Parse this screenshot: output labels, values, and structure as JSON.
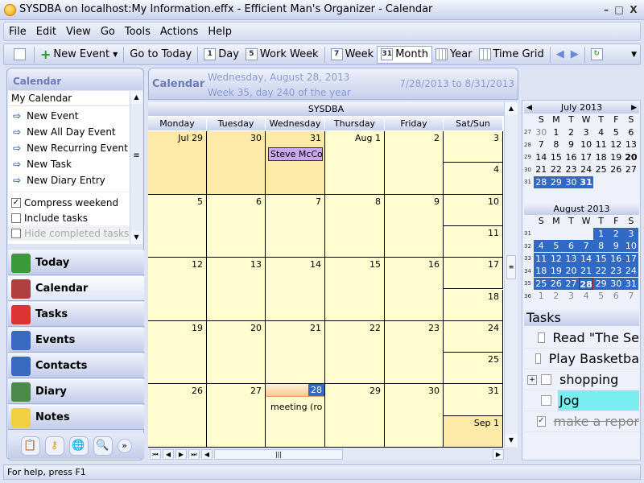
{
  "window": {
    "title": "SYSDBA on localhost:My Information.effx - Efficient Man's Organizer - Calendar"
  },
  "menu": [
    "File",
    "Edit",
    "View",
    "Go",
    "Tools",
    "Actions",
    "Help"
  ],
  "toolbar": {
    "new_event": "New Event",
    "go_today": "Go to Today",
    "day": "Day",
    "work_week": "Work Week",
    "week": "Week",
    "month": "Month",
    "year": "Year",
    "time_grid": "Time Grid",
    "day_icon": "1",
    "ww_icon": "5",
    "week_icon": "7",
    "month_icon": "31",
    "active": "Month"
  },
  "left": {
    "header": "Calendar",
    "calendar_name": "My Calendar",
    "actions": [
      "New Event",
      "New All Day Event",
      "New Recurring Event",
      "New Task",
      "New Diary Entry"
    ],
    "options": [
      {
        "label": "Compress weekend",
        "checked": true,
        "enabled": true
      },
      {
        "label": "Include tasks",
        "checked": false,
        "enabled": true
      },
      {
        "label": "Hide completed tasks",
        "checked": false,
        "enabled": false
      }
    ],
    "nav": [
      {
        "label": "Today",
        "icon": "house-icon",
        "color": "#3a9a3a"
      },
      {
        "label": "Calendar",
        "icon": "calendar-icon",
        "color": "#b04040"
      },
      {
        "label": "Tasks",
        "icon": "clipboard-check-icon",
        "color": "#d33"
      },
      {
        "label": "Events",
        "icon": "events-icon",
        "color": "#3a6ac0"
      },
      {
        "label": "Contacts",
        "icon": "contact-card-icon",
        "color": "#3a6ac0"
      },
      {
        "label": "Diary",
        "icon": "diary-icon",
        "color": "#4a8a4a"
      },
      {
        "label": "Notes",
        "icon": "note-icon",
        "color": "#f0d040"
      }
    ],
    "active_nav": "Calendar"
  },
  "main": {
    "header": "Calendar",
    "date": "Wednesday, August 28, 2013",
    "week_info": "Week 35, day 240 of the year",
    "range": "7/28/2013 to 8/31/2013",
    "owner": "SYSDBA",
    "day_headers": [
      "Monday",
      "Tuesday",
      "Wednesday",
      "Thursday",
      "Friday",
      "Sat/Sun"
    ],
    "weeks": [
      {
        "days": [
          "Jul 29",
          "30",
          "31",
          "Aug 1",
          "2"
        ],
        "sat": "3",
        "sun": "4",
        "other_month": [
          0,
          1,
          2
        ]
      },
      {
        "days": [
          "5",
          "6",
          "7",
          "8",
          "9"
        ],
        "sat": "10",
        "sun": "11",
        "other_month": []
      },
      {
        "days": [
          "12",
          "13",
          "14",
          "15",
          "16"
        ],
        "sat": "17",
        "sun": "18",
        "other_month": []
      },
      {
        "days": [
          "19",
          "20",
          "21",
          "22",
          "23"
        ],
        "sat": "24",
        "sun": "25",
        "other_month": []
      },
      {
        "days": [
          "26",
          "27",
          "28",
          "29",
          "30"
        ],
        "sat": "31",
        "sun": "Sep 1",
        "other_month": [
          "sun"
        ]
      }
    ],
    "events": [
      {
        "week": 0,
        "day": 2,
        "text": "Steve McCor",
        "color": "#c9a8f0"
      },
      {
        "week": 4,
        "day": 2,
        "text": "meeting (roor"
      }
    ],
    "today": {
      "week": 4,
      "day": 2
    }
  },
  "mini_calendars": [
    {
      "title": "July 2013",
      "dow": [
        "S",
        "M",
        "T",
        "W",
        "T",
        "F",
        "S"
      ],
      "weeks": [
        {
          "wk": "27",
          "days": [
            "30",
            "1",
            "2",
            "3",
            "4",
            "5",
            "6"
          ]
        },
        {
          "wk": "28",
          "days": [
            "7",
            "8",
            "9",
            "10",
            "11",
            "12",
            "13"
          ]
        },
        {
          "wk": "29",
          "days": [
            "14",
            "15",
            "16",
            "17",
            "18",
            "19",
            "20"
          ]
        },
        {
          "wk": "30",
          "days": [
            "21",
            "22",
            "23",
            "24",
            "25",
            "26",
            "27"
          ]
        },
        {
          "wk": "31",
          "days": [
            "28",
            "29",
            "30",
            "31",
            "",
            "",
            ""
          ]
        }
      ]
    },
    {
      "title": "August 2013",
      "dow": [
        "S",
        "M",
        "T",
        "W",
        "T",
        "F",
        "S"
      ],
      "weeks": [
        {
          "wk": "31",
          "days": [
            "",
            "",
            "",
            "",
            "1",
            "2",
            "3"
          ]
        },
        {
          "wk": "32",
          "days": [
            "4",
            "5",
            "6",
            "7",
            "8",
            "9",
            "10"
          ]
        },
        {
          "wk": "33",
          "days": [
            "11",
            "12",
            "13",
            "14",
            "15",
            "16",
            "17"
          ]
        },
        {
          "wk": "34",
          "days": [
            "18",
            "19",
            "20",
            "21",
            "22",
            "23",
            "24"
          ]
        },
        {
          "wk": "35",
          "days": [
            "25",
            "26",
            "27",
            "28",
            "29",
            "30",
            "31"
          ]
        },
        {
          "wk": "36",
          "days": [
            "1",
            "2",
            "3",
            "4",
            "5",
            "6",
            "7"
          ]
        }
      ]
    }
  ],
  "tasks": {
    "header": "Tasks",
    "items": [
      {
        "text": "Read \"The Se",
        "done": false
      },
      {
        "text": "Play Basketba",
        "done": false
      },
      {
        "text": "shopping",
        "done": false,
        "expandable": true
      },
      {
        "text": "Jog",
        "done": false,
        "highlight": "#79eef0"
      },
      {
        "text": "make a repor",
        "done": true
      }
    ]
  },
  "status": "For help, press F1"
}
